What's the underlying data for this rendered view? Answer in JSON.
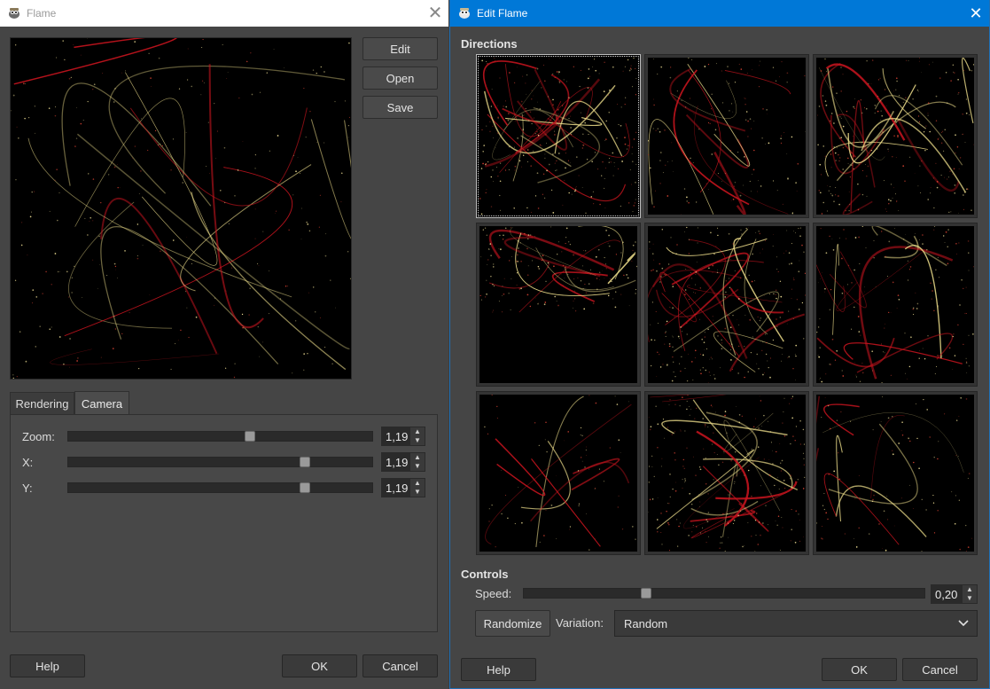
{
  "flame_window": {
    "title": "Flame",
    "side_buttons": {
      "edit": "Edit",
      "open": "Open",
      "save": "Save"
    },
    "tabs": [
      "Rendering",
      "Camera"
    ],
    "active_tab": "Camera",
    "camera": {
      "zoom": {
        "label": "Zoom:",
        "value": "1,19",
        "level": 0.6
      },
      "x": {
        "label": "X:",
        "value": "1,19",
        "level": 0.79
      },
      "y": {
        "label": "Y:",
        "value": "1,19",
        "level": 0.79
      }
    },
    "footer": {
      "help": "Help",
      "ok": "OK",
      "cancel": "Cancel"
    }
  },
  "edit_window": {
    "title": "Edit Flame",
    "directions_label": "Directions",
    "grid_cells": 9,
    "selected_cell": 0,
    "controls_label": "Controls",
    "speed": {
      "label": "Speed:",
      "value": "0,20",
      "level": 0.3
    },
    "randomize": "Randomize",
    "variation": {
      "label": "Variation:",
      "value": "Random"
    },
    "footer": {
      "help": "Help",
      "ok": "OK",
      "cancel": "Cancel"
    }
  },
  "colors": {
    "accent": "#0078d7",
    "flame_red": "#c8141e",
    "flame_yellow": "#f0e08c"
  },
  "icons": {
    "app": "gimp-icon",
    "close": "close-icon",
    "dropdown": "chevron-down-icon",
    "spin": "spin-arrows-icon"
  }
}
